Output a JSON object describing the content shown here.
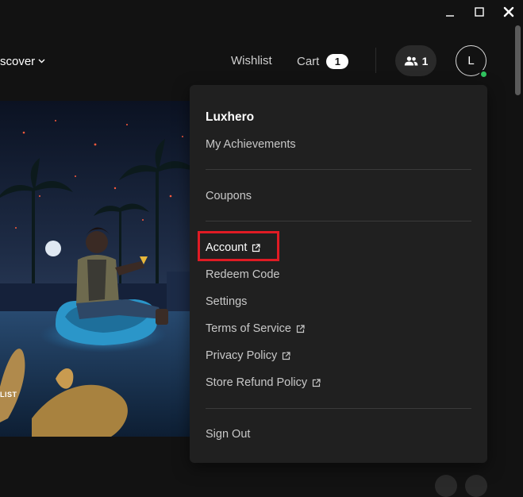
{
  "window_controls": {
    "minimize_icon": "minimize-icon",
    "maximize_icon": "maximize-icon",
    "close_icon": "close-icon"
  },
  "nav": {
    "discover": "scover",
    "wishlist": "Wishlist",
    "cart_label": "Cart",
    "cart_count": "1",
    "friends_count": "1",
    "avatar_initial": "L"
  },
  "hero": {
    "caption": "LIST"
  },
  "menu": {
    "username": "Luxhero",
    "items": [
      {
        "label": "My Achievements",
        "external": false
      },
      {
        "label": "Coupons",
        "external": false
      },
      {
        "label": "Account",
        "external": true
      },
      {
        "label": "Redeem Code",
        "external": false
      },
      {
        "label": "Settings",
        "external": false
      },
      {
        "label": "Terms of Service",
        "external": true
      },
      {
        "label": "Privacy Policy",
        "external": true
      },
      {
        "label": "Store Refund Policy",
        "external": true
      },
      {
        "label": "Sign Out",
        "external": false
      }
    ]
  },
  "colors": {
    "background": "#121212",
    "menu_bg": "#202020",
    "highlight": "#e01b24",
    "online": "#30c45f"
  }
}
